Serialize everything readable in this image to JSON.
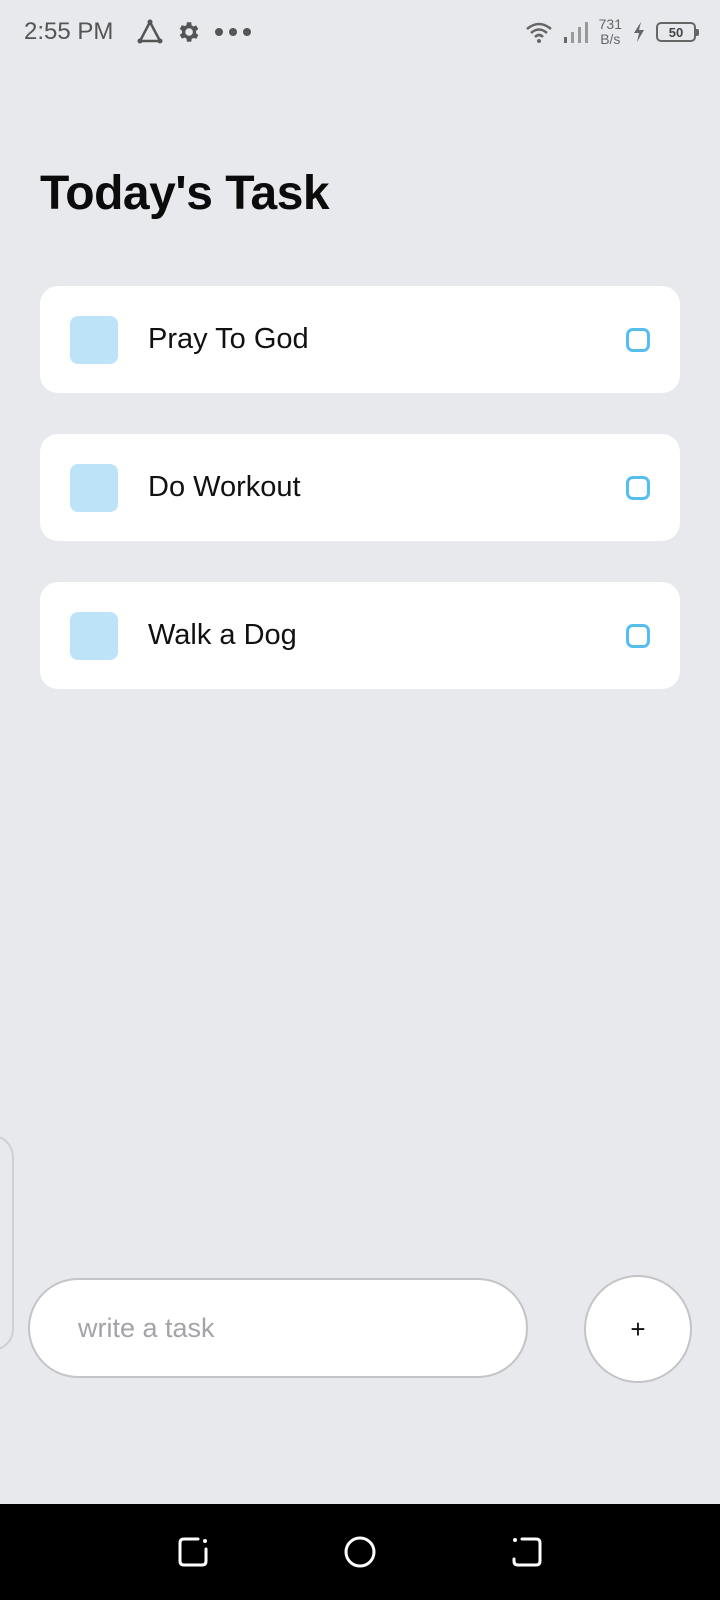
{
  "status_bar": {
    "time": "2:55 PM",
    "net_speed_value": "731",
    "net_speed_unit": "B/s",
    "battery_level": "50",
    "icons": [
      "triangle-icon",
      "gear-icon",
      "more-dots-icon",
      "wifi-icon",
      "signal-icon",
      "charging-icon",
      "battery-icon"
    ]
  },
  "page": {
    "title": "Today's Task"
  },
  "tasks": [
    {
      "label": "Pray To God",
      "completed": false
    },
    {
      "label": "Do Workout",
      "completed": false
    },
    {
      "label": "Walk a Dog",
      "completed": false
    }
  ],
  "composer": {
    "input_value": "",
    "input_placeholder": "write a task",
    "add_button_label": "+"
  },
  "nav_bar": {
    "icons": [
      "recent-apps-icon",
      "home-icon",
      "back-icon"
    ]
  },
  "colors": {
    "background": "#e8e9ed",
    "card": "#ffffff",
    "task_square": "#bde3f8",
    "checkbox_accent": "#55bdef",
    "nav_bar": "#000000"
  }
}
